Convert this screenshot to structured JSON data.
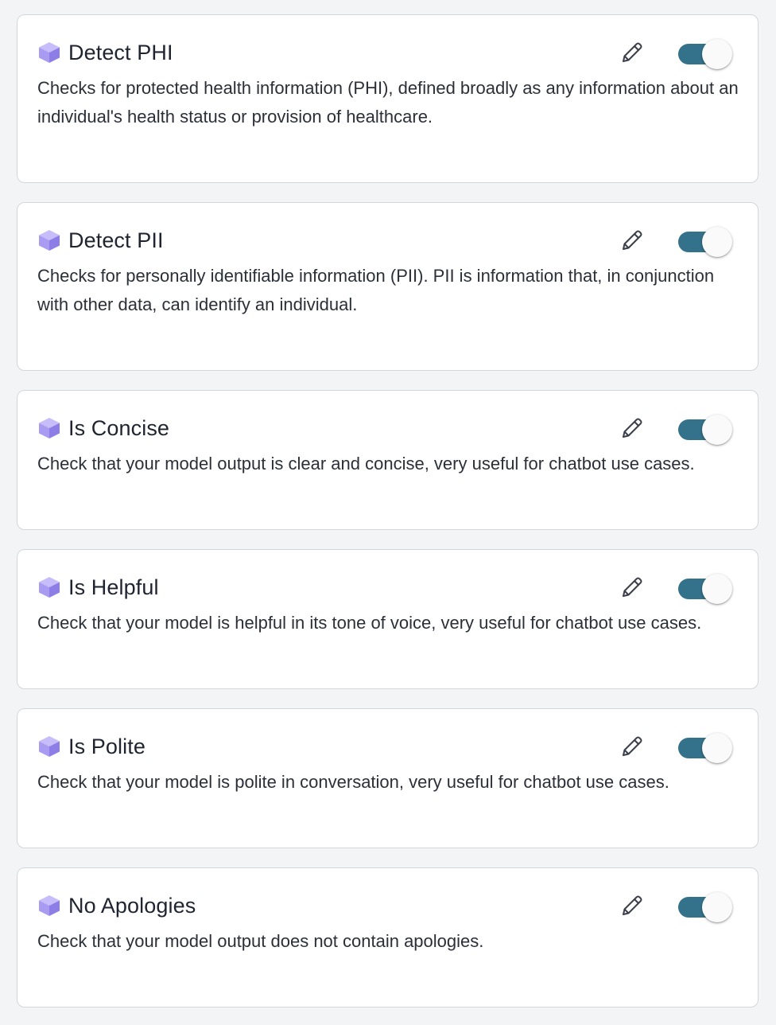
{
  "colors": {
    "background": "#f3f4f6",
    "card_border": "#d4d6db",
    "toggle_on": "#34728b",
    "cube_icon": "#a99bf2"
  },
  "guardrails": [
    {
      "title": "Detect PHI",
      "description": "Checks for protected health information (PHI), defined broadly as any information about an individual's health status or provision of healthcare.",
      "enabled": true,
      "icon": "cube-icon"
    },
    {
      "title": "Detect PII",
      "description": "Checks for personally identifiable information (PII). PII is information that, in conjunction with other data, can identify an individual.",
      "enabled": true,
      "icon": "cube-icon"
    },
    {
      "title": "Is Concise",
      "description": "Check that your model output is clear and concise, very useful for chatbot use cases.",
      "enabled": true,
      "icon": "cube-icon"
    },
    {
      "title": "Is Helpful",
      "description": "Check that your model is helpful in its tone of voice, very useful for chatbot use cases.",
      "enabled": true,
      "icon": "cube-icon"
    },
    {
      "title": "Is Polite",
      "description": "Check that your model is polite in conversation, very useful for chatbot use cases.",
      "enabled": true,
      "icon": "cube-icon"
    },
    {
      "title": "No Apologies",
      "description": "Check that your model output does not contain apologies.",
      "enabled": true,
      "icon": "cube-icon"
    }
  ]
}
